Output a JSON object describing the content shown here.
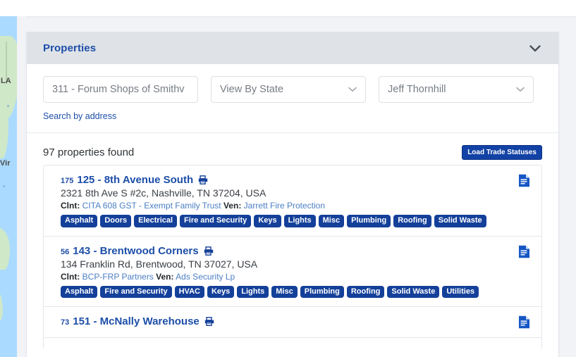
{
  "panel": {
    "title": "Properties",
    "collapse_icon": "chevron-down-icon"
  },
  "filters": {
    "property_search": {
      "value": "311 - Forum Shops of Smithv",
      "placeholder": "311 - Forum Shops of Smithv"
    },
    "state_select": {
      "value": "View By State",
      "caret_icon": "chevron-down-icon"
    },
    "owner_select": {
      "value": "Jeff Thornhill",
      "caret_icon": "chevron-down-icon"
    },
    "search_by_address_link": "Search by address"
  },
  "results": {
    "count_label": "97 properties found",
    "load_trade_statuses_button": "Load Trade Statuses",
    "properties": [
      {
        "number": "175",
        "name": "125 - 8th Avenue South",
        "print_icon": "print-icon",
        "doc_icon": "document-icon",
        "address": "2321 8th Ave S #2c, Nashville, TN 37204, USA",
        "client_label": "Clnt:",
        "client": "CITA 608 GST - Exempt Family Trust",
        "vendor_label": "Ven:",
        "vendor": "Jarrett Fire Protection",
        "tags": [
          "Asphalt",
          "Doors",
          "Electrical",
          "Fire and Security",
          "Keys",
          "Lights",
          "Misc",
          "Plumbing",
          "Roofing",
          "Solid Waste"
        ]
      },
      {
        "number": "56",
        "name": "143 - Brentwood Corners",
        "print_icon": "print-icon",
        "doc_icon": "document-icon",
        "address": "134 Franklin Rd, Brentwood, TN 37027, USA",
        "client_label": "Clnt:",
        "client": "BCP-FRP Partners",
        "vendor_label": "Ven:",
        "vendor": "Ads Security Lp",
        "tags": [
          "Asphalt",
          "Fire and Security",
          "HVAC",
          "Keys",
          "Lights",
          "Misc",
          "Plumbing",
          "Roofing",
          "Solid Waste",
          "Utilities"
        ]
      },
      {
        "number": "73",
        "name": "151 - McNally Warehouse",
        "print_icon": "print-icon",
        "doc_icon": "document-icon",
        "address": "",
        "client_label": "",
        "client": "",
        "vendor_label": "",
        "vendor": "",
        "tags": []
      }
    ]
  },
  "map": {
    "label_la": "LA",
    "label_vir": "Vir"
  },
  "colors": {
    "brand_blue": "#1d4ea8",
    "tag_blue": "#14409a",
    "button_blue": "#1242a5",
    "header_gray": "#dfe3e8",
    "page_bg": "#f1f3f6"
  }
}
